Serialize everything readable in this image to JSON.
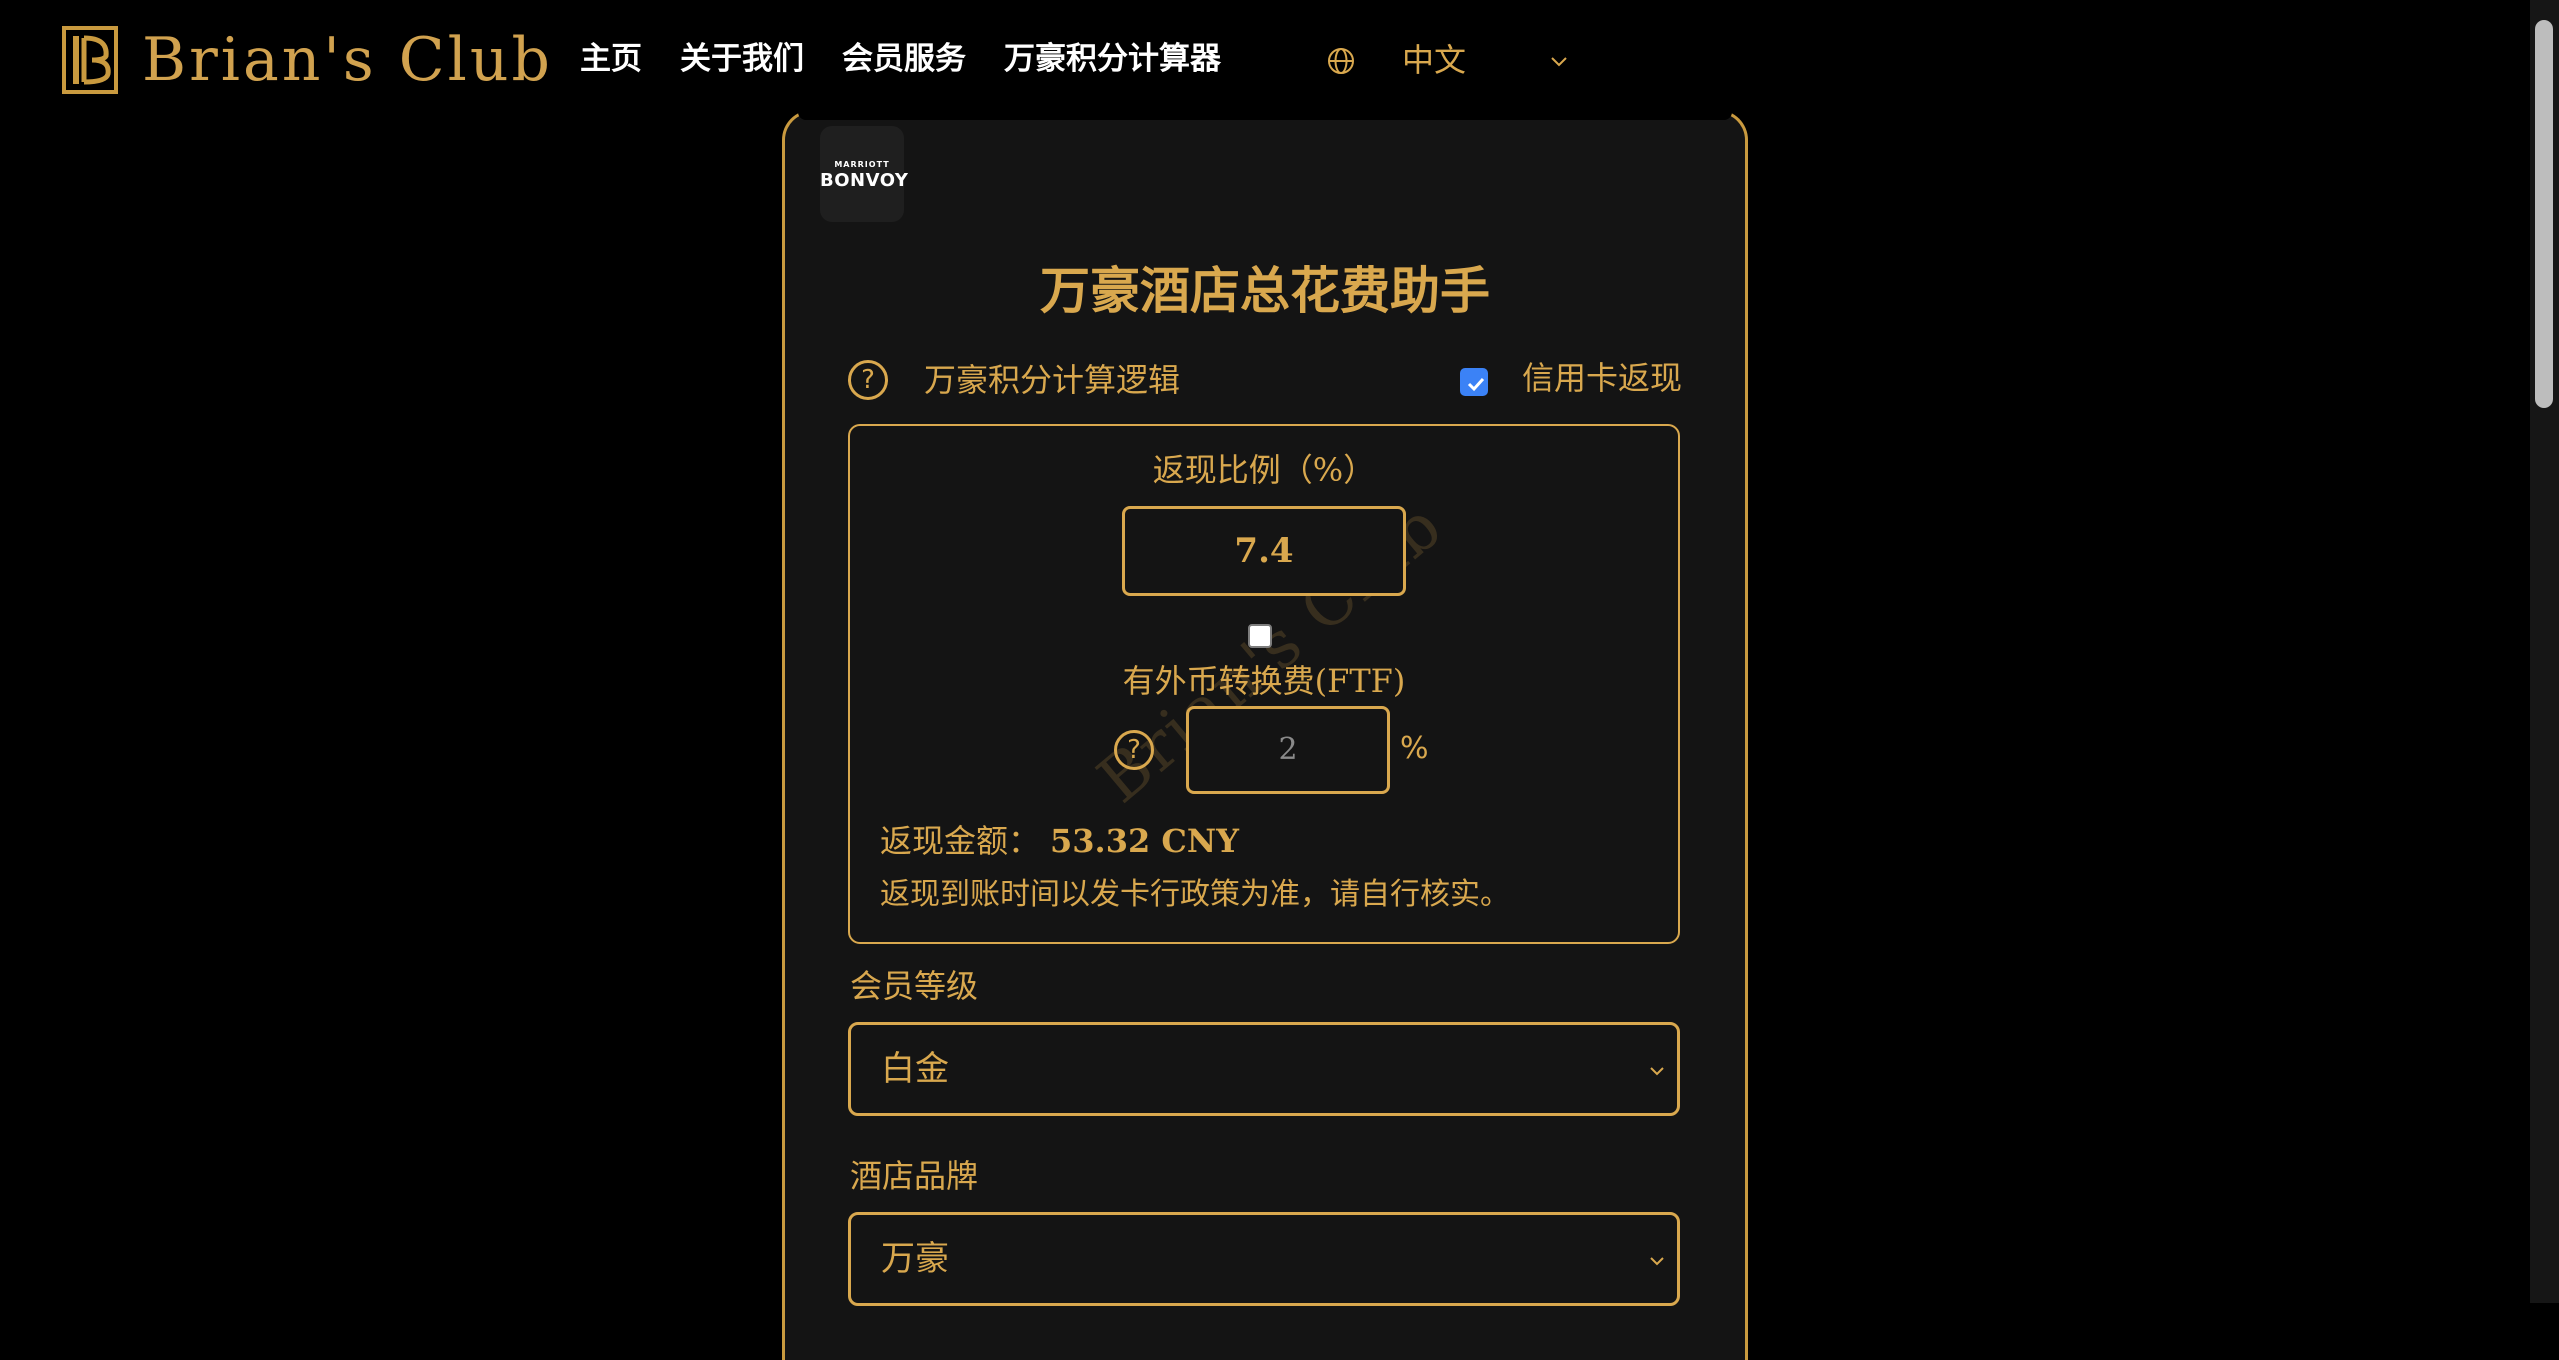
{
  "brand": {
    "name": "Brian's Club"
  },
  "nav": {
    "links": [
      "主页",
      "关于我们",
      "会员服务",
      "万豪积分计算器"
    ],
    "language": "中文"
  },
  "card": {
    "badge": {
      "top": "MARRIOTT",
      "bottom": "BONVOY"
    },
    "title": "万豪酒店总花费助手",
    "logic_help": "?",
    "logic_label": "万豪积分计算逻辑",
    "cashback_toggle_label": "信用卡返现",
    "cashback_enabled": true
  },
  "cashback": {
    "rate_label": "返现比例（%）",
    "rate_value": "7.4",
    "ftf_enabled": false,
    "ftf_label": "有外币转换费(FTF)",
    "ftf_help": "?",
    "ftf_placeholder": "2",
    "ftf_unit": "%",
    "amount_label": "返现金额：",
    "amount_value": "53.32 CNY",
    "policy_note": "返现到账时间以发卡行政策为准，请自行核实。",
    "watermark": "Brian's Club"
  },
  "fields": {
    "tier_label": "会员等级",
    "tier_value": "白金",
    "brand_label": "酒店品牌",
    "brand_value": "万豪"
  },
  "colors": {
    "accent": "#d9a84e",
    "background": "#000000",
    "card": "#141414",
    "checkbox": "#3b82f6"
  },
  "icons": [
    "brand-logo-icon",
    "globe-icon",
    "chevron-down-icon",
    "help-icon",
    "check-icon"
  ]
}
